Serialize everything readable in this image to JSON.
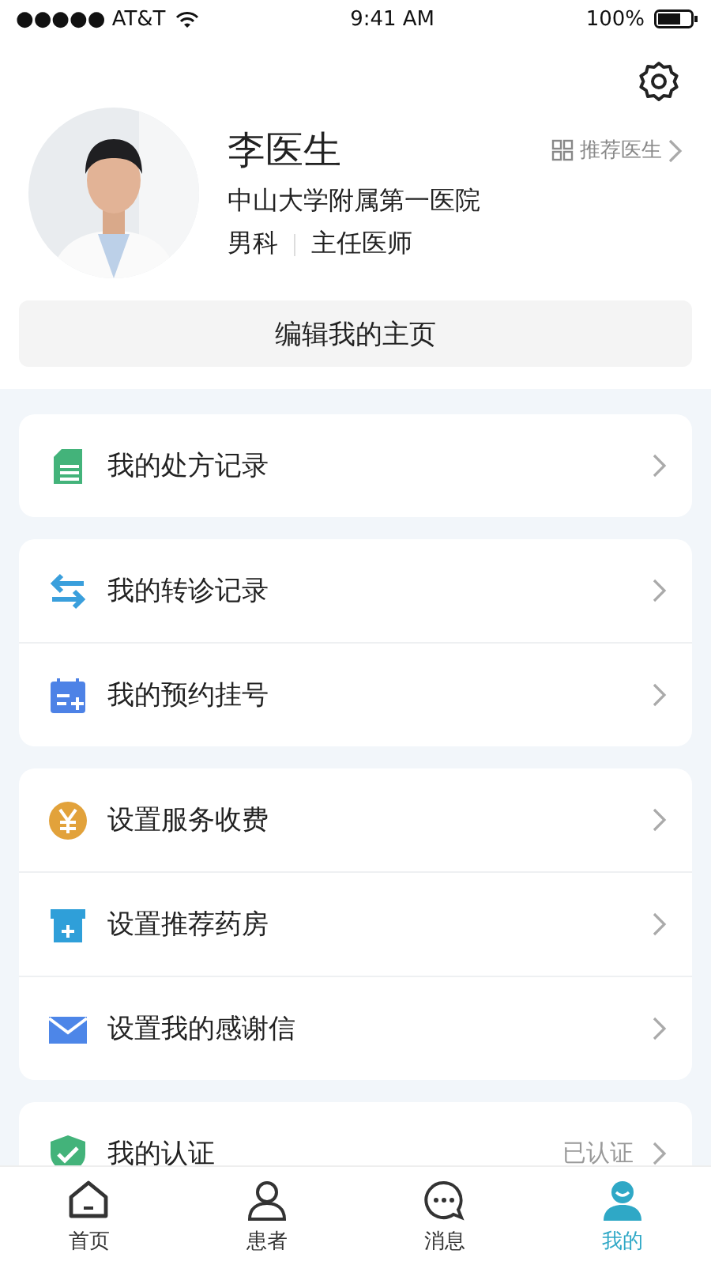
{
  "status_bar": {
    "carrier": "●●●●● AT&T",
    "time": "9:41 AM",
    "battery": "100%"
  },
  "profile": {
    "name": "李医生",
    "hospital": "中山大学附属第一医院",
    "department": "男科",
    "title": "主任医师",
    "recommend": "推荐医生"
  },
  "edit_button": "编辑我的主页",
  "menu_groups": [
    {
      "items": [
        {
          "kind": "prescription",
          "label": "我的处方记录"
        }
      ]
    },
    {
      "items": [
        {
          "kind": "transfer",
          "label": "我的转诊记录"
        },
        {
          "kind": "calendar",
          "label": "我的预约挂号"
        }
      ]
    },
    {
      "items": [
        {
          "kind": "yen",
          "label": "设置服务收费"
        },
        {
          "kind": "store",
          "label": "设置推荐药房"
        },
        {
          "kind": "mail",
          "label": "设置我的感谢信"
        }
      ]
    },
    {
      "items": [
        {
          "kind": "shield",
          "label": "我的认证",
          "value": "已认证"
        }
      ]
    }
  ],
  "tab_bar": [
    {
      "kind": "home",
      "label": "首页",
      "selected": false
    },
    {
      "kind": "patient",
      "label": "患者",
      "selected": false
    },
    {
      "kind": "message",
      "label": "消息",
      "selected": false
    },
    {
      "kind": "mine",
      "label": "我的",
      "selected": true
    }
  ]
}
